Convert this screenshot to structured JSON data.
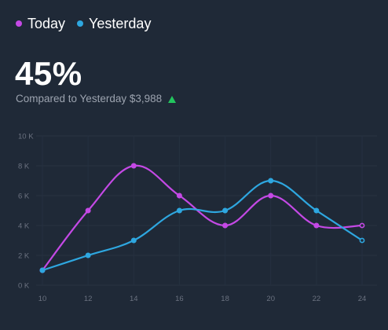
{
  "legend": {
    "today_label": "Today",
    "yesterday_label": "Yesterday"
  },
  "summary": {
    "percent": "45%",
    "compare_text": "Compared to Yesterday $3,988"
  },
  "colors": {
    "today": "#c449e5",
    "yesterday": "#2ea7e0",
    "trend_up": "#22c55e"
  },
  "chart_data": {
    "type": "line",
    "x": [
      10,
      12,
      14,
      16,
      18,
      20,
      22,
      24
    ],
    "series": [
      {
        "name": "Today",
        "values": [
          1000,
          5000,
          8000,
          6000,
          4000,
          6000,
          4000,
          4000
        ]
      },
      {
        "name": "Yesterday",
        "values": [
          1000,
          2000,
          3000,
          5000,
          5000,
          7000,
          5000,
          3000
        ]
      }
    ],
    "xlim": [
      10,
      24
    ],
    "ylim": [
      0,
      10000
    ],
    "x_ticks": [
      "10",
      "12",
      "14",
      "16",
      "18",
      "20",
      "22",
      "24"
    ],
    "y_ticks": [
      "0 K",
      "2 K",
      "4 K",
      "6 K",
      "8 K",
      "10 K"
    ],
    "grid": true,
    "legend_position": "top-left"
  }
}
